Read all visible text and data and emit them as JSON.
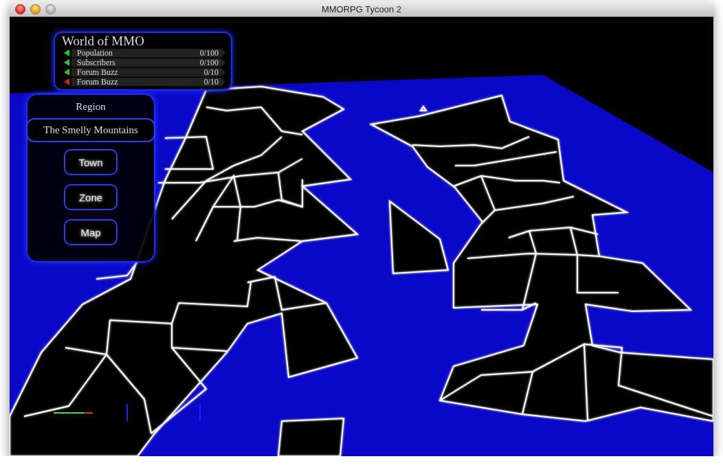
{
  "window": {
    "title": "MMORPG Tycoon 2"
  },
  "stats_panel": {
    "title": "World of MMO",
    "stats": [
      {
        "label": "Population",
        "value": "0/100",
        "color": "#22cc22"
      },
      {
        "label": "Subscribers",
        "value": "0/100",
        "color": "#22cc22"
      },
      {
        "label": "Forum Buzz",
        "value": "0/10",
        "color": "#22cc22"
      },
      {
        "label": "Forum Buzz",
        "value": "0/10",
        "color": "#cc2222"
      }
    ]
  },
  "region_panel": {
    "heading": "Region",
    "region_name": "The Smelly Mountains",
    "buttons": [
      "Town",
      "Zone",
      "Map"
    ]
  }
}
